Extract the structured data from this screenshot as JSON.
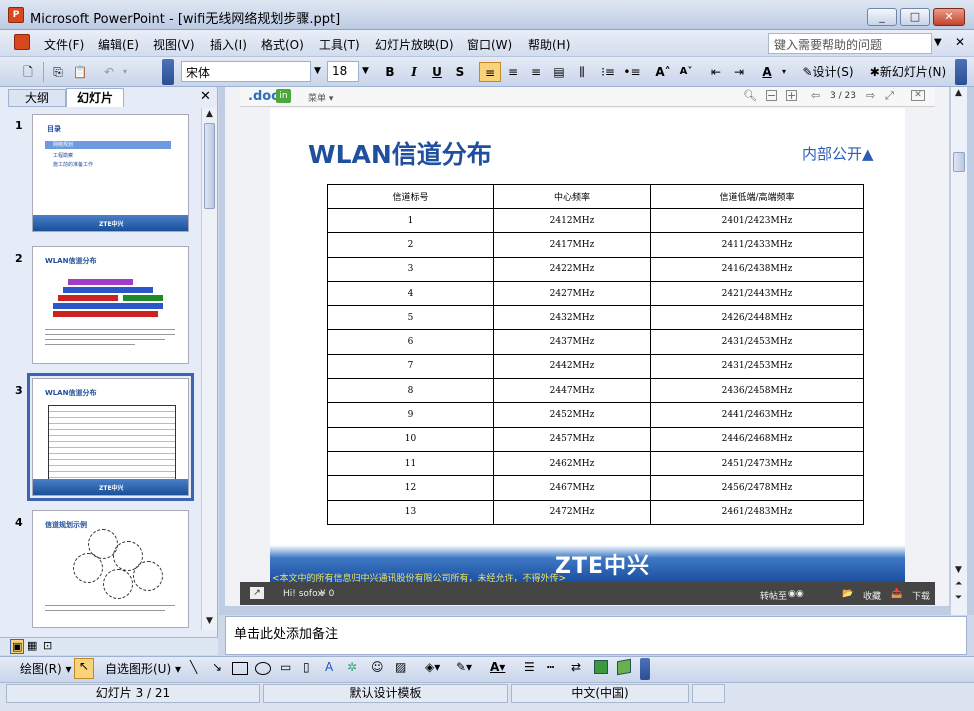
{
  "window": {
    "title": "Microsoft PowerPoint - [wifi无线网络规划步骤.ppt]",
    "app_icon": "P",
    "min": "_",
    "max": "□",
    "close": "✕"
  },
  "menu": {
    "items": [
      "文件(F)",
      "编辑(E)",
      "视图(V)",
      "插入(I)",
      "格式(O)",
      "工具(T)",
      "幻灯片放映(D)",
      "窗口(W)",
      "帮助(H)"
    ],
    "help_placeholder": "键入需要帮助的问题"
  },
  "toolbar": {
    "font_name": "宋体",
    "font_size": "18",
    "bold": "B",
    "italic": "I",
    "underline": "U",
    "shadow": "S",
    "design": "设计(S)",
    "new_slide": "新幻灯片(N)"
  },
  "left_pane": {
    "tab_outline": "大纲",
    "tab_slides": "幻灯片",
    "slide_numbers": [
      "1",
      "2",
      "3",
      "4"
    ],
    "thumb1_title": "目录",
    "thumb1_items": [
      "网络规划",
      "工程勘察",
      "施工前的准备工作"
    ],
    "thumb2_title": "WLAN信道分布",
    "thumb3_title": "WLAN信道分布",
    "thumb4_title": "信道规划示例",
    "thumb_logo": "ZTE中兴"
  },
  "doc_viewer": {
    "logo": ".doc",
    "logo_in": "in",
    "menu": "菜单 ▾",
    "page": "3 / 23",
    "user": "Hi! sofox",
    "coins": "¥ 0",
    "forward": "转帖至",
    "collect": "收藏",
    "download": "下载"
  },
  "slide": {
    "title": "WLAN信道分布",
    "tag": "内部公开▲",
    "headers": [
      "信道标号",
      "中心频率",
      "信道低端/高端频率"
    ],
    "rows": [
      [
        "1",
        "2412MHz",
        "2401/2423MHz"
      ],
      [
        "2",
        "2417MHz",
        "2411/2433MHz"
      ],
      [
        "3",
        "2422MHz",
        "2416/2438MHz"
      ],
      [
        "4",
        "2427MHz",
        "2421/2443MHz"
      ],
      [
        "5",
        "2432MHz",
        "2426/2448MHz"
      ],
      [
        "6",
        "2437MHz",
        "2431/2453MHz"
      ],
      [
        "7",
        "2442MHz",
        "2431/2453MHz"
      ],
      [
        "8",
        "2447MHz",
        "2436/2458MHz"
      ],
      [
        "9",
        "2452MHz",
        "2441/2463MHz"
      ],
      [
        "10",
        "2457MHz",
        "2446/2468MHz"
      ],
      [
        "11",
        "2462MHz",
        "2451/2473MHz"
      ],
      [
        "12",
        "2467MHz",
        "2456/2478MHz"
      ],
      [
        "13",
        "2472MHz",
        "2461/2483MHz"
      ]
    ],
    "logo": "ZTE中兴",
    "footer_note": "<本文中的所有信息归中兴通讯股份有限公司所有，未经允许，不得外传>"
  },
  "notes": {
    "placeholder": "单击此处添加备注"
  },
  "draw_toolbar": {
    "draw": "绘图(R)",
    "autoshapes": "自选图形(U)"
  },
  "status": {
    "slide": "幻灯片 3 / 21",
    "template": "默认设计模板",
    "language": "中文(中国)"
  }
}
